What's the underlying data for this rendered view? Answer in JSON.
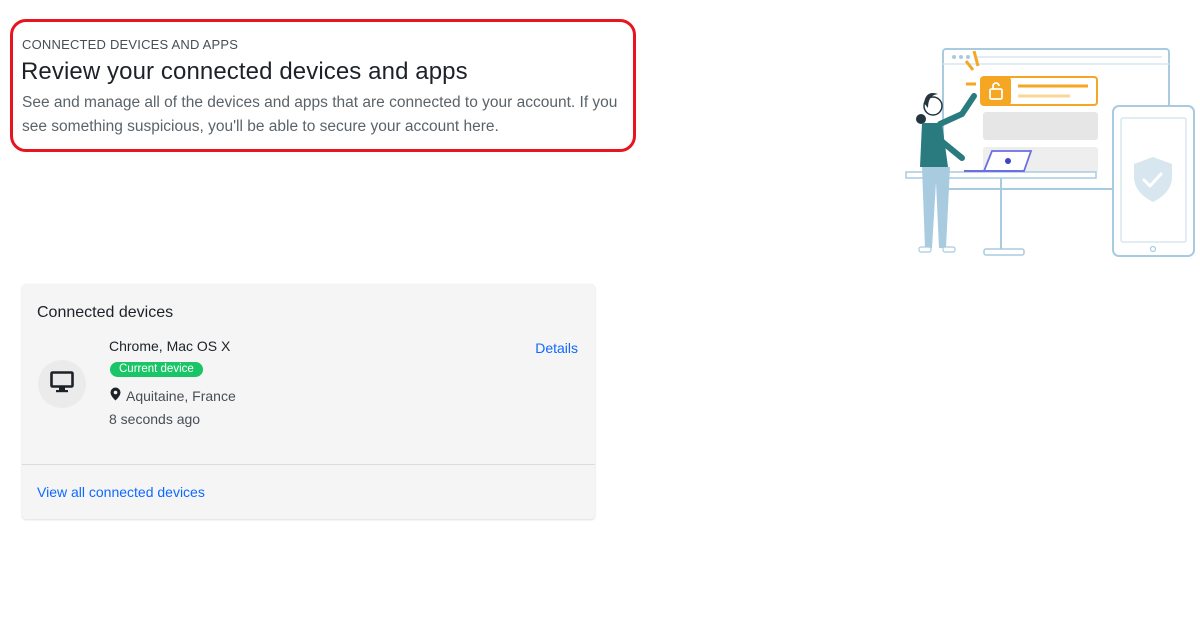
{
  "header": {
    "eyebrow": "CONNECTED DEVICES AND APPS",
    "title": "Review your connected devices and apps",
    "description": "See and manage all of the devices and apps that are connected to your account. If you see something suspicious, you'll be able to secure your account here."
  },
  "card": {
    "title": "Connected devices",
    "device": {
      "icon": "desktop-monitor-icon",
      "name": "Chrome, Mac OS X",
      "badge": "Current device",
      "location_icon": "map-pin-icon",
      "location": "Aquitaine, France",
      "last_seen": "8 seconds ago",
      "details_label": "Details"
    },
    "view_all_label": "View all connected devices"
  },
  "illustration": {
    "icon": "security-illustration"
  },
  "colors": {
    "highlight_border": "#e8141f",
    "link": "#0f69ff",
    "badge_green": "#1ac567",
    "illustration_orange": "#f5a623",
    "illustration_teal": "#2a7b80",
    "illustration_light_blue": "#a8cbe0"
  }
}
